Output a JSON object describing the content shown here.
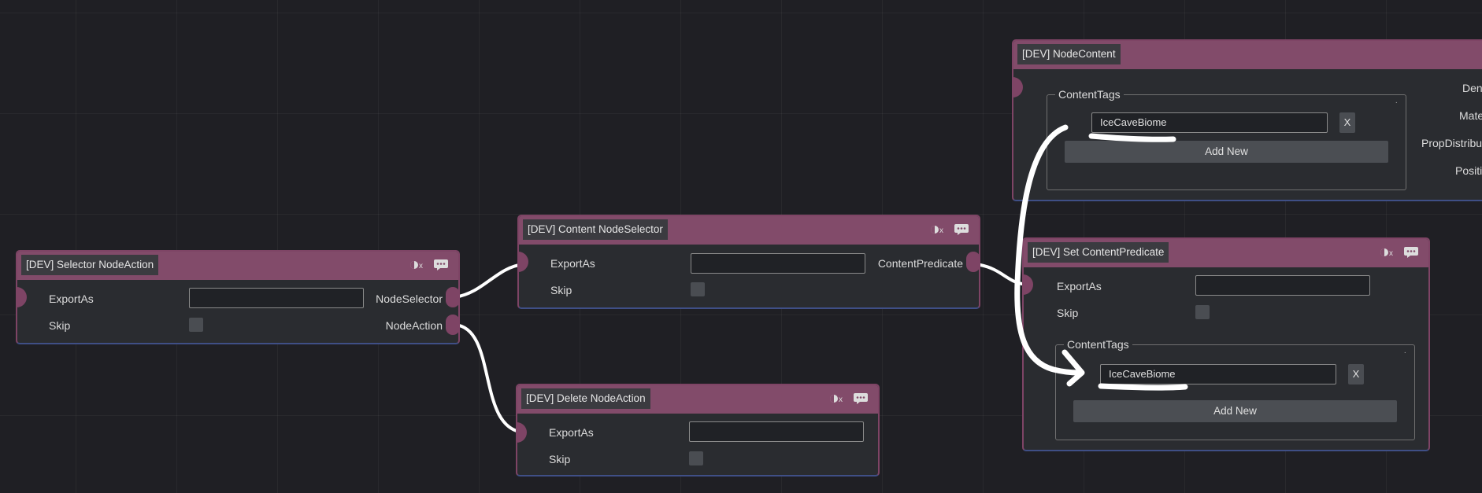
{
  "nodes": {
    "selector_nodeaction": {
      "title": "[DEV] Selector NodeAction",
      "exportas_label": "ExportAs",
      "exportas_value": "",
      "skip_label": "Skip",
      "out_nodeselector": "NodeSelector",
      "out_nodeaction": "NodeAction"
    },
    "content_nodeselector": {
      "title": "[DEV] Content NodeSelector",
      "exportas_label": "ExportAs",
      "exportas_value": "",
      "skip_label": "Skip",
      "out_contentpredicate": "ContentPredicate"
    },
    "delete_nodeaction": {
      "title": "[DEV] Delete NodeAction",
      "exportas_label": "ExportAs",
      "exportas_value": "",
      "skip_label": "Skip"
    },
    "nodecontent": {
      "title": "[DEV] NodeContent",
      "contenttags_legend": "ContentTags",
      "tag_value": "IceCaveBiome",
      "remove_label": "X",
      "add_new_label": "Add New",
      "right_labels": [
        "Dens",
        "Mate",
        "PropDistribut",
        "Positi"
      ]
    },
    "set_contentpredicate": {
      "title": "[DEV] Set ContentPredicate",
      "exportas_label": "ExportAs",
      "exportas_value": "",
      "skip_label": "Skip",
      "contenttags_legend": "ContentTags",
      "tag_value": "IceCaveBiome",
      "remove_label": "X",
      "add_new_label": "Add New"
    }
  },
  "icons": [
    "toggle-icon",
    "comment-icon"
  ],
  "colors": {
    "canvas": "#1f1f24",
    "node_body": "#2a2c30",
    "node_header": "#824b6a",
    "port": "#7e4465",
    "wire": "#ffffff",
    "node_border_bottom": "#3f4f86"
  }
}
